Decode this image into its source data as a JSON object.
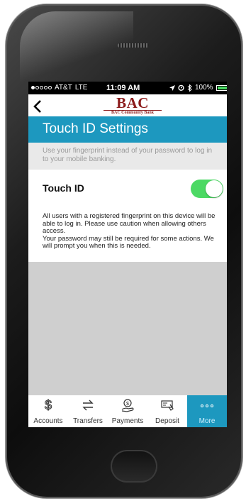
{
  "status_bar": {
    "carrier": "AT&T",
    "network": "LTE",
    "time": "11:09 AM",
    "battery": "100%",
    "battery_level": 1.0
  },
  "navbar": {
    "back_label": "<",
    "logo_text": "BAC",
    "logo_subtitle": "BAC Community Bank"
  },
  "page": {
    "title": "Touch ID Settings",
    "description": "Use your fingerprint instead of your password to log in to your mobile banking."
  },
  "touch_id": {
    "label": "Touch ID",
    "enabled": true
  },
  "info": {
    "line1": "All users with a registered fingerprint on this device will be able to log in. Please use caution when allowing others access.",
    "line2": "Your password may still be required for some actions. We will prompt you when this is needed."
  },
  "tabbar": {
    "items": [
      {
        "label": "Accounts",
        "icon": "dollar-icon"
      },
      {
        "label": "Transfers",
        "icon": "transfer-icon"
      },
      {
        "label": "Payments",
        "icon": "payment-icon"
      },
      {
        "label": "Deposit",
        "icon": "check-deposit-icon"
      },
      {
        "label": "More",
        "icon": "more-dots-icon"
      }
    ],
    "active_index": 4
  },
  "colors": {
    "accent": "#1d98bf",
    "toggle_on": "#4cd964",
    "logo": "#8c1c1c"
  }
}
